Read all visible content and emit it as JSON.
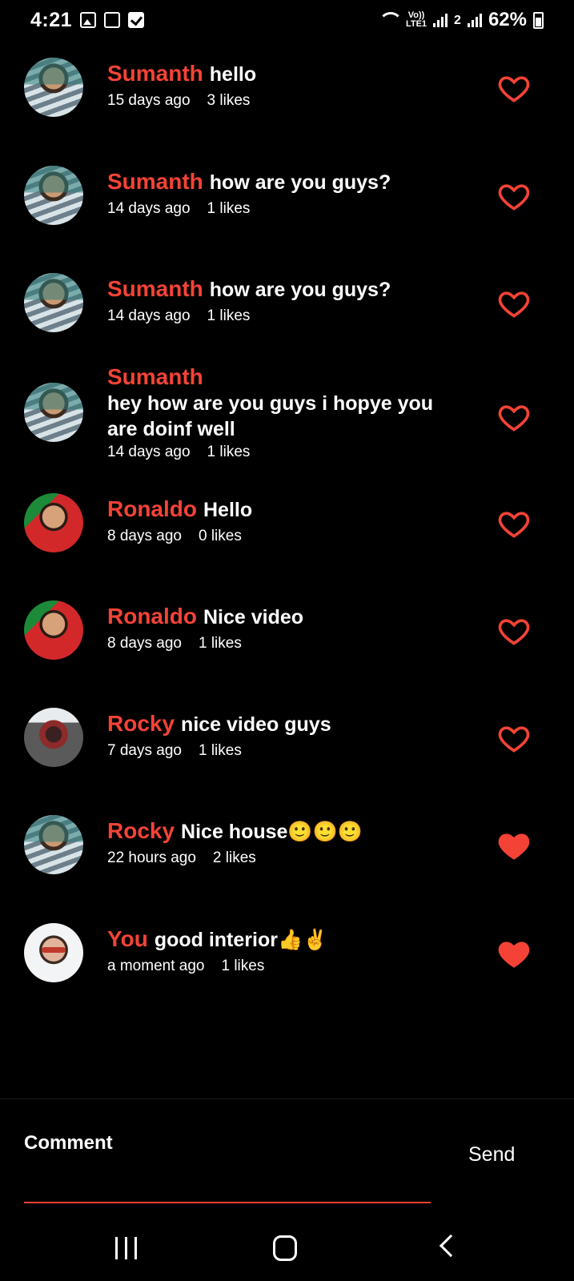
{
  "status_bar": {
    "time": "4:21",
    "network_label_top": "Vo))",
    "network_label_bottom": "LTE1",
    "sim2_label": "2",
    "battery_percent": "62%"
  },
  "colors": {
    "accent": "#f44336",
    "background": "#000000",
    "text": "#ffffff"
  },
  "comments": [
    {
      "name": "Sumanth",
      "text": "hello",
      "time": "15 days ago",
      "likes": "3 likes",
      "liked": false,
      "avatar": "messi"
    },
    {
      "name": "Sumanth",
      "text": "how are you guys?",
      "time": "14 days ago",
      "likes": "1 likes",
      "liked": false,
      "avatar": "messi"
    },
    {
      "name": "Sumanth",
      "text": "how are you guys?",
      "time": "14 days ago",
      "likes": "1 likes",
      "liked": false,
      "avatar": "messi"
    },
    {
      "name": "Sumanth",
      "text": "hey how are you guys i hopye you are doinf well",
      "time": "14 days ago",
      "likes": "1 likes",
      "liked": false,
      "avatar": "messi"
    },
    {
      "name": "Ronaldo",
      "text": "Hello",
      "time": "8 days ago",
      "likes": "0 likes",
      "liked": false,
      "avatar": "ronaldo"
    },
    {
      "name": "Ronaldo",
      "text": "Nice video",
      "time": "8 days ago",
      "likes": "1 likes",
      "liked": false,
      "avatar": "ronaldo"
    },
    {
      "name": "Rocky",
      "text": "nice video guys",
      "time": "7 days ago",
      "likes": "1 likes",
      "liked": false,
      "avatar": "rocky"
    },
    {
      "name": "Rocky",
      "text": "Nice house🙂🙂🙂",
      "time": "22 hours ago",
      "likes": "2 likes",
      "liked": true,
      "avatar": "messi"
    },
    {
      "name": "You",
      "text": "good interior👍✌️",
      "time": "a moment ago",
      "likes": "1 likes",
      "liked": true,
      "avatar": "you"
    }
  ],
  "composer": {
    "placeholder": "Comment",
    "send_label": "Send"
  },
  "nav": {
    "recent_icon": "recent-apps-icon",
    "home_icon": "home-icon",
    "back_icon": "back-icon"
  }
}
